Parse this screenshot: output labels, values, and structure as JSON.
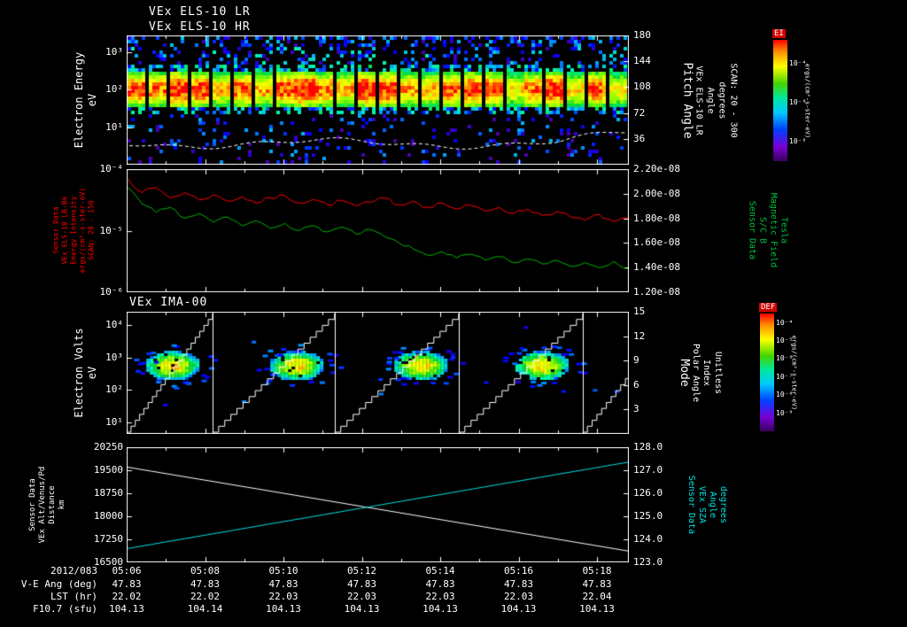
{
  "time_axis": {
    "date": "2012/083",
    "ticks": [
      "05:06",
      "05:08",
      "05:10",
      "05:12",
      "05:14",
      "05:16",
      "05:18"
    ]
  },
  "info_rows": [
    {
      "label": "V-E Ang (deg)",
      "values": [
        "47.83",
        "47.83",
        "47.83",
        "47.83",
        "47.83",
        "47.83",
        "47.83"
      ]
    },
    {
      "label": "LST (hr)",
      "values": [
        "22.02",
        "22.02",
        "22.03",
        "22.03",
        "22.03",
        "22.03",
        "22.04"
      ]
    },
    {
      "label": "F10.7 (sfu)",
      "values": [
        "104.13",
        "104.14",
        "104.13",
        "104.13",
        "104.13",
        "104.13",
        "104.13"
      ]
    }
  ],
  "chart_data": [
    {
      "id": "els-energy-spectrogram",
      "type": "heatmap",
      "title": "VEx ELS-10 LR",
      "title2": "VEx ELS-10 HR",
      "ylabel_lines": [
        "Electron Energy",
        "eV"
      ],
      "yaxis": {
        "scale": "log",
        "units": "eV",
        "top_exp": 3.45,
        "bottom_exp": 0,
        "ticks": [
          {
            "exp": 3,
            "label": "10³"
          },
          {
            "exp": 2,
            "label": "10²"
          },
          {
            "exp": 1,
            "label": "10¹"
          }
        ]
      },
      "right_axis": {
        "label_lines": [
          "Pitch Angle",
          "VEx ELS-10 LR",
          "Angle",
          "degrees",
          "SCAN: 20 - 300"
        ],
        "top": 180,
        "bottom": 0,
        "ticks": [
          "180",
          "144",
          "108",
          "72",
          "36"
        ]
      },
      "colorbar": {
        "title": "EI",
        "units": "ergs/(cm²-s-ster-eV)",
        "ticks": [
          "10⁻⁴",
          "10⁻⁶",
          "10⁻⁸"
        ],
        "tick_fracs": [
          0.2,
          0.52,
          0.84
        ]
      },
      "content": {
        "description": "Electron energy-time spectrogram: intense flux band between ~30 and ~400 eV peaking near 100 eV, sparse low-flux speckle elsewhere, ~24 telemetry segments separated by black gaps, dashed white trace near the bottom",
        "band_peak_log10_eV": 2.05,
        "band_sigma_log10": 0.38,
        "segments": 24
      }
    },
    {
      "id": "els-intensity-and-magnetic-field",
      "type": "line",
      "left_axis": {
        "label_lines": [
          "Sensor Data",
          "VEx ELS-10 LR-Bk",
          "Energy Intensity",
          "ergs/(cm²-s-ster-eV)",
          "SCAN: 20 - 150"
        ],
        "scale": "log",
        "top_exp": -4,
        "bottom_exp": -6,
        "ticks": [
          {
            "exp": -4,
            "label": "10⁻⁴"
          },
          {
            "exp": -5,
            "label": "10⁻⁵"
          },
          {
            "exp": -6,
            "label": "10⁻⁶"
          }
        ],
        "color": "#ff0000"
      },
      "right_axis": {
        "label_lines": [
          "Sensor Data",
          "S/C B",
          "Magnetic Field",
          "Tesla"
        ],
        "top": 2.2e-08,
        "bottom": 1.2e-08,
        "ticks": [
          "2.20e-08",
          "2.00e-08",
          "1.80e-08",
          "1.60e-08",
          "1.40e-08",
          "1.20e-08"
        ],
        "color": "#00c040"
      },
      "series": [
        {
          "name": "ELS-10 LR-Bk Energy Intensity",
          "axis": "left",
          "color": "#ff0000",
          "log10_values": [
            -4.15,
            -4.38,
            -4.3,
            -4.47,
            -4.38,
            -4.5,
            -4.42,
            -4.52,
            -4.45,
            -4.55,
            -4.47,
            -4.43,
            -4.55,
            -4.49,
            -4.58,
            -4.51,
            -4.6,
            -4.54,
            -4.47,
            -4.58,
            -4.52,
            -4.62,
            -4.55,
            -4.65,
            -4.59,
            -4.68,
            -4.62,
            -4.72,
            -4.65,
            -4.75,
            -4.69,
            -4.78,
            -4.83,
            -4.74,
            -4.85,
            -4.8
          ]
        },
        {
          "name": "S/C B Magnetic Field (1e-8 Tesla)",
          "axis": "right",
          "color": "#00b400",
          "values_1e8": [
            2.05,
            1.92,
            1.85,
            1.89,
            1.8,
            1.84,
            1.77,
            1.81,
            1.74,
            1.78,
            1.72,
            1.76,
            1.7,
            1.74,
            1.69,
            1.73,
            1.67,
            1.71,
            1.65,
            1.6,
            1.55,
            1.5,
            1.53,
            1.48,
            1.51,
            1.46,
            1.49,
            1.44,
            1.47,
            1.43,
            1.46,
            1.41,
            1.44,
            1.4,
            1.45,
            1.39
          ]
        }
      ]
    },
    {
      "id": "ima-spectrogram",
      "type": "heatmap",
      "title": "VEx IMA-00",
      "ylabel_lines": [
        "Electron Volts",
        "eV"
      ],
      "yaxis": {
        "scale": "log",
        "units": "eV",
        "top_exp": 4.4,
        "bottom_exp": 0.65,
        "ticks": [
          {
            "exp": 4,
            "label": "10⁴"
          },
          {
            "exp": 3,
            "label": "10³"
          },
          {
            "exp": 2,
            "label": "10²"
          },
          {
            "exp": 1,
            "label": "10¹"
          }
        ]
      },
      "right_axis": {
        "label_lines": [
          "Mode",
          "Polar Angle",
          "Index",
          "Unitless"
        ],
        "top": 15,
        "bottom": 0,
        "ticks": [
          "15",
          "12",
          "9",
          "6",
          "3"
        ]
      },
      "colorbar": {
        "title": "DEF",
        "units": "ergs/(cm²-s-ster-eV)",
        "ticks": [
          "10⁻⁴",
          "10⁻⁵",
          "10⁻⁶",
          "10⁻⁷",
          "10⁻⁸",
          "10⁻⁹"
        ],
        "tick_fracs": [
          0.08,
          0.23,
          0.38,
          0.54,
          0.69,
          0.85
        ]
      },
      "content": {
        "description": "Ion mass analyzer energy-time spectrogram: four ion flux blobs near 500-1000 eV, white staircase lines showing the instrument energy sweep / mode index, vertical lines at sweep boundaries",
        "blob_x_fracs": [
          0.092,
          0.339,
          0.586,
          0.827
        ],
        "blob_center_log10_eV": 2.75,
        "sweep_boundaries_x_fracs": [
          0.171,
          0.414,
          0.661,
          0.908
        ]
      }
    },
    {
      "id": "altitude-and-sza",
      "type": "line",
      "left_axis": {
        "label_lines": [
          "Sensor Data",
          "VEx Alt/Venus/Pd",
          "Distance",
          "km"
        ],
        "top": 20250,
        "bottom": 16500,
        "ticks": [
          "20250",
          "19500",
          "18750",
          "18000",
          "17250",
          "16500"
        ],
        "color": "#ffffff"
      },
      "right_axis": {
        "label_lines": [
          "Sensor Data",
          "VEx SZA",
          "Angle",
          "degrees"
        ],
        "top": 128.0,
        "bottom": 123.0,
        "ticks": [
          "128.0",
          "127.0",
          "126.0",
          "125.0",
          "124.0",
          "123.0"
        ],
        "color": "#00e0e0"
      },
      "series": [
        {
          "name": "VEx Alt/Venus/Pd Distance (km)",
          "axis": "left",
          "color": "#ffffff",
          "x_fracs": [
            0,
            1
          ],
          "values": [
            19600,
            16870
          ]
        },
        {
          "name": "VEx SZA Angle (degrees)",
          "axis": "right",
          "color": "#00e0e0",
          "x_fracs": [
            0,
            1
          ],
          "values": [
            123.6,
            127.35
          ]
        }
      ]
    }
  ]
}
